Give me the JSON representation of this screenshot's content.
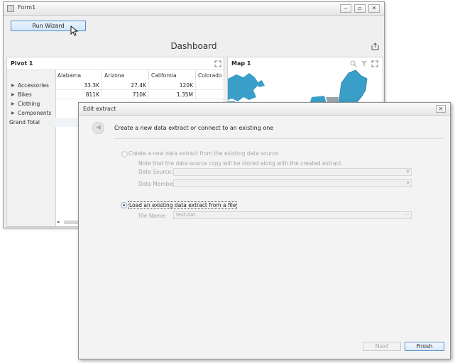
{
  "form": {
    "title": "Form1",
    "minimize_label": "‒",
    "maximize_label": "▫",
    "close_label": "✕",
    "run_wizard_label": "Run Wizard",
    "dashboard_title": "Dashboard"
  },
  "pivot": {
    "title": "Pivot 1",
    "columns": [
      "Alabama",
      "Arizona",
      "California",
      "Colorado"
    ],
    "rows": [
      {
        "label": "Accessories",
        "values": [
          "33.3K",
          "27.4K",
          "120K",
          ""
        ]
      },
      {
        "label": "Bikes",
        "values": [
          "811K",
          "710K",
          "1.35M",
          ""
        ]
      },
      {
        "label": "Clothing",
        "values": [
          "",
          "",
          "",
          ""
        ]
      },
      {
        "label": "Components",
        "values": [
          "",
          "",
          "",
          ""
        ]
      },
      {
        "label": "Grand Total",
        "values": [
          "",
          "",
          "",
          ""
        ]
      }
    ],
    "scroll_left": "◂"
  },
  "map": {
    "title": "Map 1"
  },
  "dialog": {
    "title": "Edit extract",
    "close_label": "✕",
    "back_label": "◀",
    "heading": "Create a new data extract or connect to an existing one",
    "option1_label": "Create a new data extract from the existing data source",
    "option1_note": "Note that the data source copy will be stored along with the created extract.",
    "data_source_label": "Data Source:",
    "data_source_value": "",
    "data_member_label": "Data Member:",
    "data_member_value": "",
    "option2_label": "Load an existing data extract from a file",
    "file_name_label": "File Name:",
    "file_name_value": "test.dat",
    "browse_label": "···",
    "next_label": "Next",
    "finish_label": "Finish"
  },
  "colors": {
    "map_fill": "#3a9fc8",
    "accent": "#4f8fd0"
  }
}
